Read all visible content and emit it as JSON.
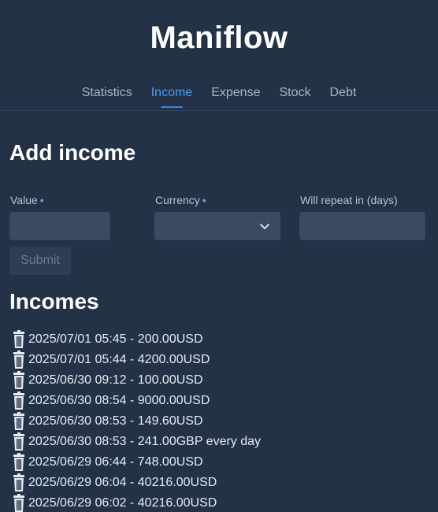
{
  "app": {
    "title": "Maniflow"
  },
  "nav": {
    "tabs": [
      {
        "label": "Statistics"
      },
      {
        "label": "Income"
      },
      {
        "label": "Expense"
      },
      {
        "label": "Stock"
      },
      {
        "label": "Debt"
      }
    ],
    "active": "Income"
  },
  "form": {
    "heading": "Add income",
    "value_label": "Value",
    "currency_label": "Currency",
    "repeat_label": "Will repeat in (days)",
    "required_marker": "•",
    "value": "",
    "currency": "",
    "repeat": "",
    "submit_label": "Submit"
  },
  "list": {
    "heading": "Incomes",
    "items": [
      "2025/07/01 05:45 - 200.00USD",
      "2025/07/01 05:44 - 4200.00USD",
      "2025/06/30 09:12 - 100.00USD",
      "2025/06/30 08:54 - 9000.00USD",
      "2025/06/30 08:53 - 149.60USD",
      "2025/06/30 08:53 - 241.00GBP every day",
      "2025/06/29 06:44 - 748.00USD",
      "2025/06/29 06:04 - 40216.00USD",
      "2025/06/29 06:02 - 40216.00USD"
    ]
  },
  "colors": {
    "background": "#233247",
    "accent": "#3b82f6",
    "input": "#3b4a62"
  },
  "icons": {
    "delete": "trash-icon",
    "select": "chevron-down-icon"
  }
}
